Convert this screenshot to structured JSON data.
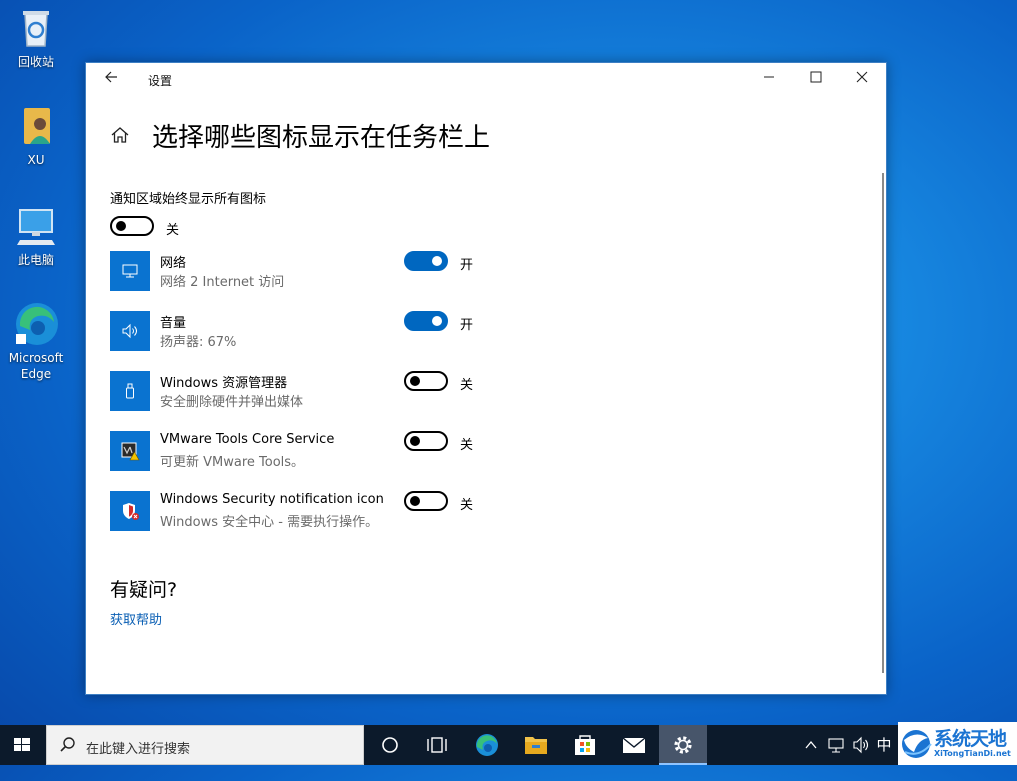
{
  "desktop": {
    "icons": [
      {
        "label": "回收站",
        "icon": "recycle-bin-icon"
      },
      {
        "label": "XU",
        "icon": "user-folder-icon"
      },
      {
        "label": "此电脑",
        "icon": "computer-icon"
      },
      {
        "label": "Microsoft Edge",
        "icon": "edge-icon"
      }
    ]
  },
  "window": {
    "title": "设置",
    "page_title": "选择哪些图标显示在任务栏上",
    "always_show": {
      "label": "通知区域始终显示所有图标",
      "state_text": "关",
      "on": false
    },
    "items": [
      {
        "title": "网络",
        "subtitle": "网络 2 Internet 访问",
        "state_text": "开",
        "on": true,
        "icon": "network-icon"
      },
      {
        "title": "音量",
        "subtitle": "扬声器: 67%",
        "state_text": "开",
        "on": true,
        "icon": "volume-icon"
      },
      {
        "title": "Windows 资源管理器",
        "subtitle": "安全删除硬件并弹出媒体",
        "state_text": "关",
        "on": false,
        "icon": "usb-eject-icon"
      },
      {
        "title": "VMware Tools Core Service",
        "subtitle": "可更新 VMware Tools。",
        "state_text": "关",
        "on": false,
        "icon": "vmware-tools-icon"
      },
      {
        "title": "Windows Security notification icon",
        "subtitle": "Windows 安全中心 - 需要执行操作。",
        "state_text": "关",
        "on": false,
        "icon": "security-shield-icon"
      }
    ],
    "help": {
      "title": "有疑问?",
      "link": "获取帮助"
    }
  },
  "taskbar": {
    "search_placeholder": "在此键入进行搜索",
    "ime": "中",
    "pinned": [
      "cortana-icon",
      "task-view-icon",
      "edge-icon",
      "file-explorer-icon",
      "store-icon",
      "mail-icon",
      "settings-icon"
    ],
    "active": "settings-icon"
  },
  "watermark": {
    "main": "系统天地",
    "sub": "XiTongTianDi.net"
  },
  "colors": {
    "accent": "#0067c0",
    "tile": "#0a73d0",
    "taskbar": "#0c1a2b",
    "link": "#0a5fb4"
  }
}
